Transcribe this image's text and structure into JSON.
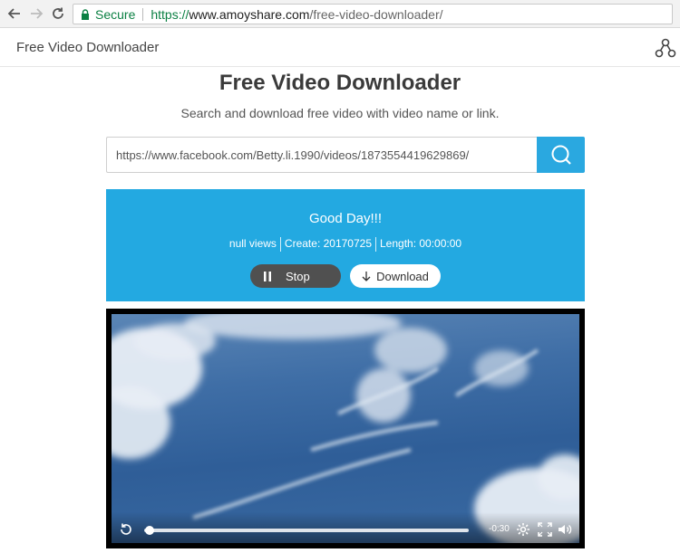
{
  "browser": {
    "secure_label": "Secure",
    "url_scheme": "https://",
    "url_host": "www.amoyshare.com",
    "url_path": "/free-video-downloader/"
  },
  "header": {
    "site_title": "Free Video Downloader",
    "share_icon": "share-icon"
  },
  "main": {
    "title": "Free Video Downloader",
    "subtitle": "Search and download free video with video name or link.",
    "search": {
      "value": "https://www.facebook.com/Betty.li.1990/videos/1873554419629869/",
      "button_icon": "search-icon"
    }
  },
  "result": {
    "title": "Good Day!!!",
    "views": "null views",
    "create": "Create: 20170725",
    "length": "Length: 00:00:00",
    "stop_label": "Stop",
    "download_label": "Download",
    "accent": "#23a9e1"
  },
  "player": {
    "time": "-0:30",
    "progress": 0.01
  }
}
